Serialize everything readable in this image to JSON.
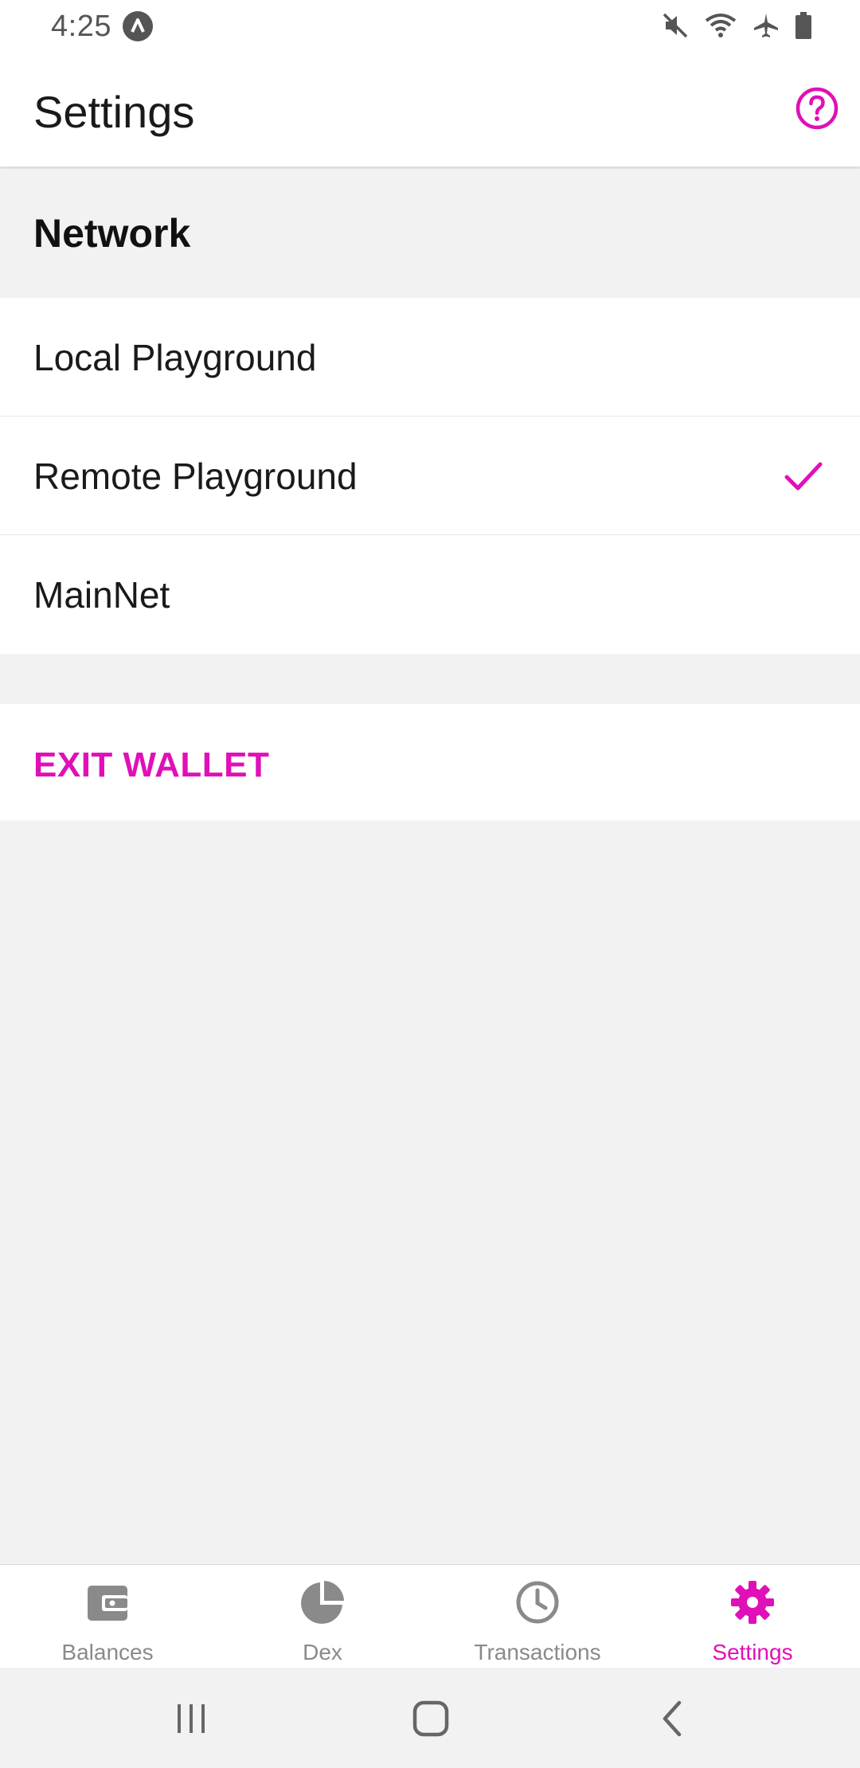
{
  "status_bar": {
    "time": "4:25",
    "icons": [
      "app-a-icon",
      "mute-icon",
      "wifi-icon",
      "airplane-icon",
      "battery-icon"
    ]
  },
  "header": {
    "title": "Settings",
    "help_icon": "help-circle-icon"
  },
  "network": {
    "section_title": "Network",
    "items": [
      {
        "label": "Local Playground",
        "selected": false
      },
      {
        "label": "Remote Playground",
        "selected": true
      },
      {
        "label": "MainNet",
        "selected": false
      }
    ]
  },
  "exit": {
    "label": "EXIT WALLET"
  },
  "tabs": [
    {
      "label": "Balances",
      "icon": "wallet-icon",
      "active": false
    },
    {
      "label": "Dex",
      "icon": "pie-chart-icon",
      "active": false
    },
    {
      "label": "Transactions",
      "icon": "clock-icon",
      "active": false
    },
    {
      "label": "Settings",
      "icon": "gear-icon",
      "active": true
    }
  ],
  "system_nav": [
    "recents-button",
    "home-button",
    "back-button"
  ],
  "colors": {
    "accent": "#e010b8",
    "inactive": "#8a8a8a",
    "background": "#f2f2f2",
    "surface": "#ffffff"
  }
}
